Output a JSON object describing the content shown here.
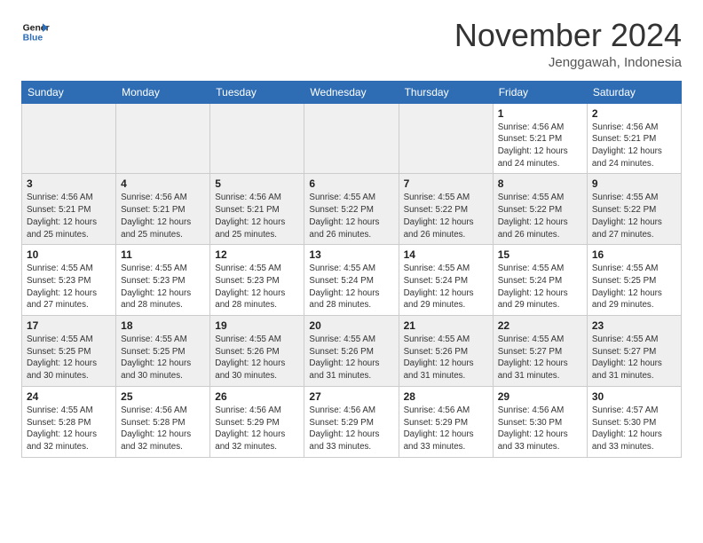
{
  "header": {
    "logo_line1": "General",
    "logo_line2": "Blue",
    "month": "November 2024",
    "location": "Jenggawah, Indonesia"
  },
  "weekdays": [
    "Sunday",
    "Monday",
    "Tuesday",
    "Wednesday",
    "Thursday",
    "Friday",
    "Saturday"
  ],
  "rows": [
    [
      {
        "day": "",
        "info": ""
      },
      {
        "day": "",
        "info": ""
      },
      {
        "day": "",
        "info": ""
      },
      {
        "day": "",
        "info": ""
      },
      {
        "day": "",
        "info": ""
      },
      {
        "day": "1",
        "info": "Sunrise: 4:56 AM\nSunset: 5:21 PM\nDaylight: 12 hours\nand 24 minutes."
      },
      {
        "day": "2",
        "info": "Sunrise: 4:56 AM\nSunset: 5:21 PM\nDaylight: 12 hours\nand 24 minutes."
      }
    ],
    [
      {
        "day": "3",
        "info": "Sunrise: 4:56 AM\nSunset: 5:21 PM\nDaylight: 12 hours\nand 25 minutes."
      },
      {
        "day": "4",
        "info": "Sunrise: 4:56 AM\nSunset: 5:21 PM\nDaylight: 12 hours\nand 25 minutes."
      },
      {
        "day": "5",
        "info": "Sunrise: 4:56 AM\nSunset: 5:21 PM\nDaylight: 12 hours\nand 25 minutes."
      },
      {
        "day": "6",
        "info": "Sunrise: 4:55 AM\nSunset: 5:22 PM\nDaylight: 12 hours\nand 26 minutes."
      },
      {
        "day": "7",
        "info": "Sunrise: 4:55 AM\nSunset: 5:22 PM\nDaylight: 12 hours\nand 26 minutes."
      },
      {
        "day": "8",
        "info": "Sunrise: 4:55 AM\nSunset: 5:22 PM\nDaylight: 12 hours\nand 26 minutes."
      },
      {
        "day": "9",
        "info": "Sunrise: 4:55 AM\nSunset: 5:22 PM\nDaylight: 12 hours\nand 27 minutes."
      }
    ],
    [
      {
        "day": "10",
        "info": "Sunrise: 4:55 AM\nSunset: 5:23 PM\nDaylight: 12 hours\nand 27 minutes."
      },
      {
        "day": "11",
        "info": "Sunrise: 4:55 AM\nSunset: 5:23 PM\nDaylight: 12 hours\nand 28 minutes."
      },
      {
        "day": "12",
        "info": "Sunrise: 4:55 AM\nSunset: 5:23 PM\nDaylight: 12 hours\nand 28 minutes."
      },
      {
        "day": "13",
        "info": "Sunrise: 4:55 AM\nSunset: 5:24 PM\nDaylight: 12 hours\nand 28 minutes."
      },
      {
        "day": "14",
        "info": "Sunrise: 4:55 AM\nSunset: 5:24 PM\nDaylight: 12 hours\nand 29 minutes."
      },
      {
        "day": "15",
        "info": "Sunrise: 4:55 AM\nSunset: 5:24 PM\nDaylight: 12 hours\nand 29 minutes."
      },
      {
        "day": "16",
        "info": "Sunrise: 4:55 AM\nSunset: 5:25 PM\nDaylight: 12 hours\nand 29 minutes."
      }
    ],
    [
      {
        "day": "17",
        "info": "Sunrise: 4:55 AM\nSunset: 5:25 PM\nDaylight: 12 hours\nand 30 minutes."
      },
      {
        "day": "18",
        "info": "Sunrise: 4:55 AM\nSunset: 5:25 PM\nDaylight: 12 hours\nand 30 minutes."
      },
      {
        "day": "19",
        "info": "Sunrise: 4:55 AM\nSunset: 5:26 PM\nDaylight: 12 hours\nand 30 minutes."
      },
      {
        "day": "20",
        "info": "Sunrise: 4:55 AM\nSunset: 5:26 PM\nDaylight: 12 hours\nand 31 minutes."
      },
      {
        "day": "21",
        "info": "Sunrise: 4:55 AM\nSunset: 5:26 PM\nDaylight: 12 hours\nand 31 minutes."
      },
      {
        "day": "22",
        "info": "Sunrise: 4:55 AM\nSunset: 5:27 PM\nDaylight: 12 hours\nand 31 minutes."
      },
      {
        "day": "23",
        "info": "Sunrise: 4:55 AM\nSunset: 5:27 PM\nDaylight: 12 hours\nand 31 minutes."
      }
    ],
    [
      {
        "day": "24",
        "info": "Sunrise: 4:55 AM\nSunset: 5:28 PM\nDaylight: 12 hours\nand 32 minutes."
      },
      {
        "day": "25",
        "info": "Sunrise: 4:56 AM\nSunset: 5:28 PM\nDaylight: 12 hours\nand 32 minutes."
      },
      {
        "day": "26",
        "info": "Sunrise: 4:56 AM\nSunset: 5:29 PM\nDaylight: 12 hours\nand 32 minutes."
      },
      {
        "day": "27",
        "info": "Sunrise: 4:56 AM\nSunset: 5:29 PM\nDaylight: 12 hours\nand 33 minutes."
      },
      {
        "day": "28",
        "info": "Sunrise: 4:56 AM\nSunset: 5:29 PM\nDaylight: 12 hours\nand 33 minutes."
      },
      {
        "day": "29",
        "info": "Sunrise: 4:56 AM\nSunset: 5:30 PM\nDaylight: 12 hours\nand 33 minutes."
      },
      {
        "day": "30",
        "info": "Sunrise: 4:57 AM\nSunset: 5:30 PM\nDaylight: 12 hours\nand 33 minutes."
      }
    ]
  ],
  "colors": {
    "header_bg": "#2e6db4",
    "header_text": "#ffffff",
    "row_odd": "#ffffff",
    "row_even": "#efefef",
    "empty_odd": "#e8e8e8",
    "empty_even": "#e0e0e0"
  }
}
